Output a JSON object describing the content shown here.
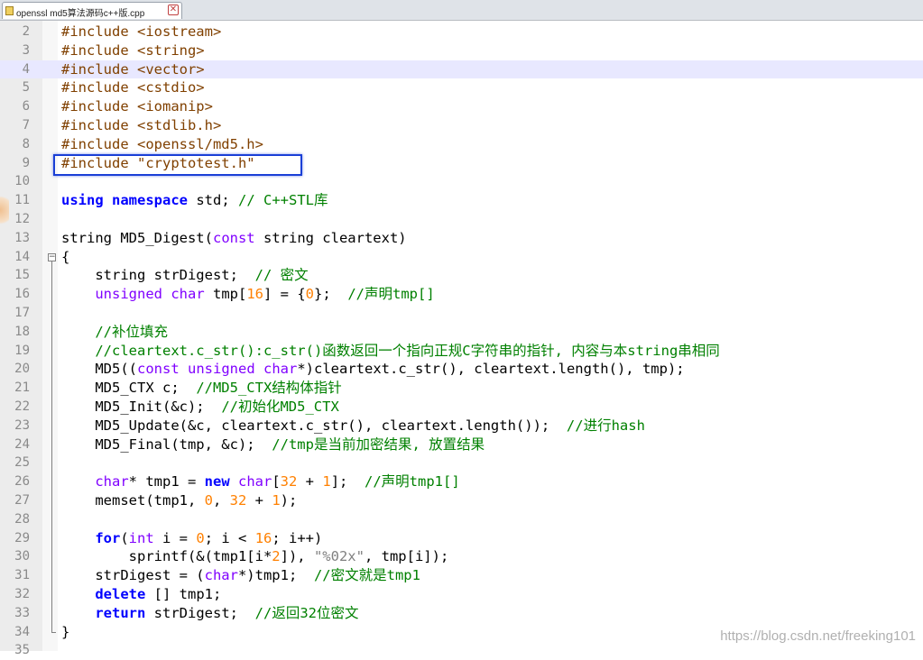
{
  "tab": {
    "label": "openssl md5算法源码c++版.cpp",
    "close_glyph": "✕"
  },
  "watermark": "https://blog.csdn.net/freeking101",
  "lines": [
    {
      "n": "2",
      "tokens": [
        {
          "t": "#include <iostream>",
          "c": "pp"
        }
      ]
    },
    {
      "n": "3",
      "tokens": [
        {
          "t": "#include <string>",
          "c": "pp"
        }
      ]
    },
    {
      "n": "4",
      "tokens": [
        {
          "t": "#include <vector>",
          "c": "pp"
        }
      ],
      "current": true
    },
    {
      "n": "5",
      "tokens": [
        {
          "t": "#include <cstdio>",
          "c": "pp"
        }
      ]
    },
    {
      "n": "6",
      "tokens": [
        {
          "t": "#include <iomanip>",
          "c": "pp"
        }
      ]
    },
    {
      "n": "7",
      "tokens": [
        {
          "t": "#include <stdlib.h>",
          "c": "pp"
        }
      ]
    },
    {
      "n": "8",
      "tokens": [
        {
          "t": "#include <openssl/md5.h>",
          "c": "pp"
        }
      ]
    },
    {
      "n": "9",
      "tokens": [
        {
          "t": "#include \"cryptotest.h\"",
          "c": "pp"
        }
      ]
    },
    {
      "n": "10",
      "tokens": []
    },
    {
      "n": "11",
      "tokens": [
        {
          "t": "using",
          "c": "kw"
        },
        {
          "t": " ",
          "c": ""
        },
        {
          "t": "namespace",
          "c": "kw"
        },
        {
          "t": " std; ",
          "c": ""
        },
        {
          "t": "// C++STL库",
          "c": "cm"
        }
      ]
    },
    {
      "n": "12",
      "tokens": []
    },
    {
      "n": "13",
      "tokens": [
        {
          "t": "string MD5_Digest(",
          "c": ""
        },
        {
          "t": "const",
          "c": "ty"
        },
        {
          "t": " string cleartext)",
          "c": ""
        }
      ]
    },
    {
      "n": "14",
      "tokens": [
        {
          "t": "{",
          "c": ""
        }
      ],
      "fold": "open"
    },
    {
      "n": "15",
      "tokens": [
        {
          "t": "    string strDigest;  ",
          "c": ""
        },
        {
          "t": "// 密文",
          "c": "cm"
        }
      ]
    },
    {
      "n": "16",
      "tokens": [
        {
          "t": "    ",
          "c": ""
        },
        {
          "t": "unsigned",
          "c": "ty"
        },
        {
          "t": " ",
          "c": ""
        },
        {
          "t": "char",
          "c": "ty"
        },
        {
          "t": " tmp[",
          "c": ""
        },
        {
          "t": "16",
          "c": "num"
        },
        {
          "t": "] = {",
          "c": ""
        },
        {
          "t": "0",
          "c": "num"
        },
        {
          "t": "};  ",
          "c": ""
        },
        {
          "t": "//声明tmp[]",
          "c": "cm"
        }
      ]
    },
    {
      "n": "17",
      "tokens": []
    },
    {
      "n": "18",
      "tokens": [
        {
          "t": "    ",
          "c": ""
        },
        {
          "t": "//补位填充",
          "c": "cm"
        }
      ]
    },
    {
      "n": "19",
      "tokens": [
        {
          "t": "    ",
          "c": ""
        },
        {
          "t": "//cleartext.c_str():c_str()函数返回一个指向正规C字符串的指针, 内容与本string串相同",
          "c": "cm"
        }
      ]
    },
    {
      "n": "20",
      "tokens": [
        {
          "t": "    MD5((",
          "c": ""
        },
        {
          "t": "const",
          "c": "ty"
        },
        {
          "t": " ",
          "c": ""
        },
        {
          "t": "unsigned",
          "c": "ty"
        },
        {
          "t": " ",
          "c": ""
        },
        {
          "t": "char",
          "c": "ty"
        },
        {
          "t": "*)cleartext.c_str(), cleartext.length(), tmp);",
          "c": ""
        }
      ]
    },
    {
      "n": "21",
      "tokens": [
        {
          "t": "    MD5_CTX c;  ",
          "c": ""
        },
        {
          "t": "//MD5_CTX结构体指针",
          "c": "cm"
        }
      ]
    },
    {
      "n": "22",
      "tokens": [
        {
          "t": "    MD5_Init(&c);  ",
          "c": ""
        },
        {
          "t": "//初始化MD5_CTX",
          "c": "cm"
        }
      ]
    },
    {
      "n": "23",
      "tokens": [
        {
          "t": "    MD5_Update(&c, cleartext.c_str(), cleartext.length());  ",
          "c": ""
        },
        {
          "t": "//进行hash",
          "c": "cm"
        }
      ]
    },
    {
      "n": "24",
      "tokens": [
        {
          "t": "    MD5_Final(tmp, &c);  ",
          "c": ""
        },
        {
          "t": "//tmp是当前加密结果, 放置结果",
          "c": "cm"
        }
      ]
    },
    {
      "n": "25",
      "tokens": []
    },
    {
      "n": "26",
      "tokens": [
        {
          "t": "    ",
          "c": ""
        },
        {
          "t": "char",
          "c": "ty"
        },
        {
          "t": "* tmp1 = ",
          "c": ""
        },
        {
          "t": "new",
          "c": "kw"
        },
        {
          "t": " ",
          "c": ""
        },
        {
          "t": "char",
          "c": "ty"
        },
        {
          "t": "[",
          "c": ""
        },
        {
          "t": "32",
          "c": "num"
        },
        {
          "t": " + ",
          "c": ""
        },
        {
          "t": "1",
          "c": "num"
        },
        {
          "t": "];  ",
          "c": ""
        },
        {
          "t": "//声明tmp1[]",
          "c": "cm"
        }
      ]
    },
    {
      "n": "27",
      "tokens": [
        {
          "t": "    memset(tmp1, ",
          "c": ""
        },
        {
          "t": "0",
          "c": "num"
        },
        {
          "t": ", ",
          "c": ""
        },
        {
          "t": "32",
          "c": "num"
        },
        {
          "t": " + ",
          "c": ""
        },
        {
          "t": "1",
          "c": "num"
        },
        {
          "t": ");",
          "c": ""
        }
      ]
    },
    {
      "n": "28",
      "tokens": []
    },
    {
      "n": "29",
      "tokens": [
        {
          "t": "    ",
          "c": ""
        },
        {
          "t": "for",
          "c": "kw"
        },
        {
          "t": "(",
          "c": ""
        },
        {
          "t": "int",
          "c": "ty"
        },
        {
          "t": " i = ",
          "c": ""
        },
        {
          "t": "0",
          "c": "num"
        },
        {
          "t": "; i < ",
          "c": ""
        },
        {
          "t": "16",
          "c": "num"
        },
        {
          "t": "; i++)",
          "c": ""
        }
      ]
    },
    {
      "n": "30",
      "tokens": [
        {
          "t": "        sprintf(&(tmp1[i*",
          "c": ""
        },
        {
          "t": "2",
          "c": "num"
        },
        {
          "t": "]), ",
          "c": ""
        },
        {
          "t": "\"%02x\"",
          "c": "str"
        },
        {
          "t": ", tmp[i]);",
          "c": ""
        }
      ]
    },
    {
      "n": "31",
      "tokens": [
        {
          "t": "    strDigest = (",
          "c": ""
        },
        {
          "t": "char",
          "c": "ty"
        },
        {
          "t": "*)tmp1;  ",
          "c": ""
        },
        {
          "t": "//密文就是tmp1",
          "c": "cm"
        }
      ]
    },
    {
      "n": "32",
      "tokens": [
        {
          "t": "    ",
          "c": ""
        },
        {
          "t": "delete",
          "c": "kw"
        },
        {
          "t": " [] tmp1;",
          "c": ""
        }
      ]
    },
    {
      "n": "33",
      "tokens": [
        {
          "t": "    ",
          "c": ""
        },
        {
          "t": "return",
          "c": "kw"
        },
        {
          "t": " strDigest;  ",
          "c": ""
        },
        {
          "t": "//返回32位密文",
          "c": "cm"
        }
      ]
    },
    {
      "n": "34",
      "tokens": [
        {
          "t": "}",
          "c": ""
        }
      ],
      "fold": "end"
    },
    {
      "n": "35",
      "tokens": []
    }
  ]
}
